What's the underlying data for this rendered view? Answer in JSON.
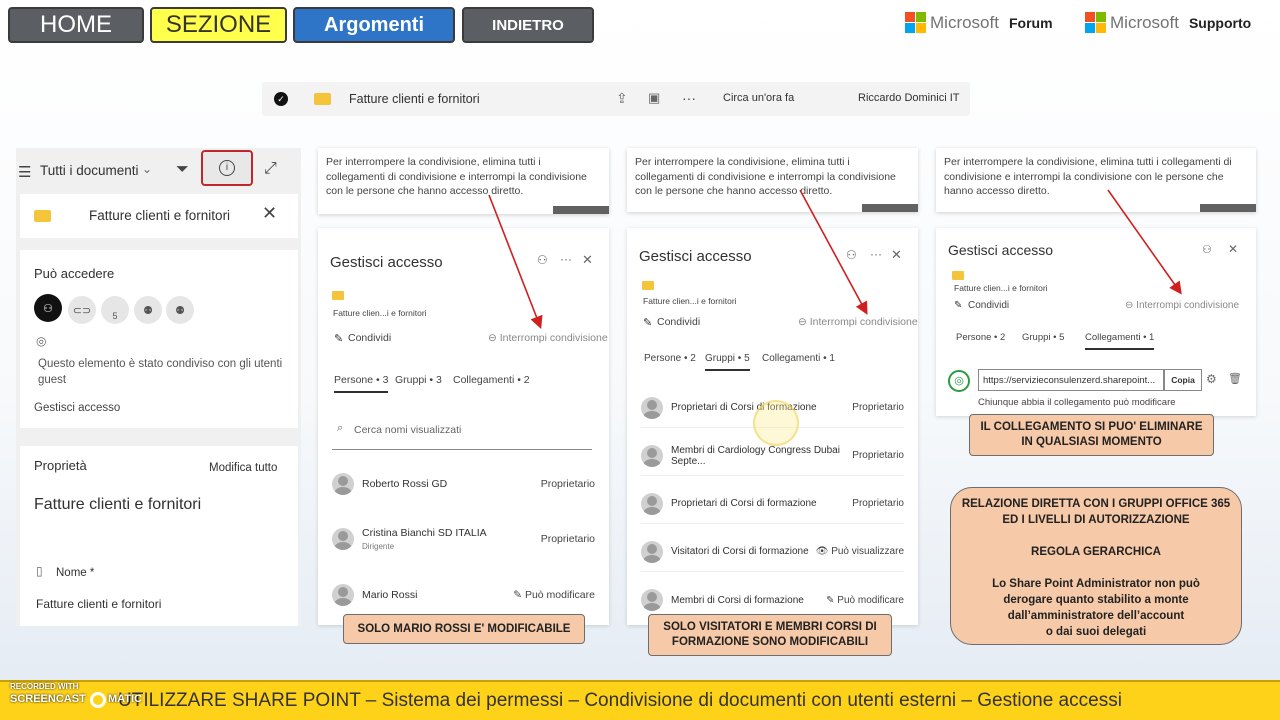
{
  "nav": {
    "home": "HOME",
    "sezione": "SEZIONE",
    "argomenti": "Argomenti",
    "indietro": "INDIETRO"
  },
  "ms_links": {
    "brand": "Microsoft",
    "forum": "Forum",
    "supporto": "Supporto"
  },
  "filebar": {
    "name": "Fatture clienti e fornitori",
    "more": "···",
    "time": "Circa un'ora fa",
    "owner": "Riccardo Dominici IT"
  },
  "left": {
    "view": "Tutti i documenti",
    "title": "Fatture clienti e fornitori",
    "access_heading": "Può accedere",
    "badge_count": "5",
    "shared_msg": "Questo elemento è stato condiviso con gli utenti guest",
    "manage": "Gestisci accesso",
    "props": "Proprietà",
    "edit_all": "Modifica tutto",
    "doc_title": "Fatture clienti e fornitori",
    "name_label": "Nome *",
    "name_value": "Fatture clienti e fornitori"
  },
  "tooltip_text": "Per interrompere la condivisione, elimina tutti i collegamenti di condivisione e interrompi la condivisione con le persone che hanno accesso diretto.",
  "panel1": {
    "title": "Gestisci accesso",
    "folder": "Fatture clien...i e fornitori",
    "share": "Condividi",
    "stop": "Interrompi condivisione",
    "tabs": [
      "Persone • 3",
      "Gruppi • 3",
      "Collegamenti • 2"
    ],
    "search_placeholder": "Cerca nomi visualizzati",
    "rows": [
      {
        "name": "Roberto Rossi GD",
        "sub": "",
        "role": "Proprietario"
      },
      {
        "name": "Cristina Bianchi SD ITALIA",
        "sub": "Dirigente",
        "role": "Proprietario"
      },
      {
        "name": "Mario Rossi",
        "sub": "",
        "role": "Può modificare"
      }
    ]
  },
  "panel2": {
    "title": "Gestisci accesso",
    "folder": "Fatture clien...i e fornitori",
    "share": "Condividi",
    "stop": "Interrompi condivisione",
    "tabs": [
      "Persone • 2",
      "Gruppi • 5",
      "Collegamenti • 1"
    ],
    "rows": [
      {
        "name": "Proprietari di Corsi di formazione",
        "role": "Proprietario"
      },
      {
        "name": "Membri di Cardiology Congress Dubai Septe...",
        "role": "Proprietario"
      },
      {
        "name": "Proprietari di Corsi di formazione",
        "role": "Proprietario"
      },
      {
        "name": "Visitatori di Corsi di formazione",
        "role": "Può visualizzare"
      },
      {
        "name": "Membri di Corsi di formazione",
        "role": "Può modificare"
      }
    ]
  },
  "panel3": {
    "title": "Gestisci accesso",
    "folder": "Fatture clien...i e fornitori",
    "share": "Condividi",
    "stop": "Interrompi condivisione",
    "tabs": [
      "Persone • 2",
      "Gruppi • 5",
      "Collegamenti • 1"
    ],
    "link": "https://servizieconsulenzerd.sharepoint...",
    "copy": "Copia",
    "link_desc": "Chiunque abbia il collegamento può modificare"
  },
  "notes": {
    "n1": "SOLO MARIO ROSSI E' MODIFICABILE",
    "n2_1": "SOLO VISITATORI E MEMBRI CORSI DI",
    "n2_2": "FORMAZIONE SONO MODIFICABILI",
    "n3_1": "IL COLLEGAMENTO SI PUO' ELIMINARE",
    "n3_2": "IN QUALSIASI MOMENTO",
    "big_1": "RELAZIONE DIRETTA CON I GRUPPI OFFICE 365",
    "big_2": "ED I LIVELLI DI AUTORIZZAZIONE",
    "big_3": "REGOLA GERARCHICA",
    "big_4": "Lo Share Point Administrator non può",
    "big_5": "derogare quanto stabilito a monte",
    "big_6": "dall’amministratore dell’account",
    "big_7": "o dai suoi delegati"
  },
  "banner": "UTILIZZARE SHARE POINT – Sistema dei permessi – Condivisione di documenti con utenti esterni – Gestione accessi",
  "watermark": {
    "line1": "RECORDED WITH",
    "line2": "SCREENCAST",
    "line3": "MATIC"
  }
}
